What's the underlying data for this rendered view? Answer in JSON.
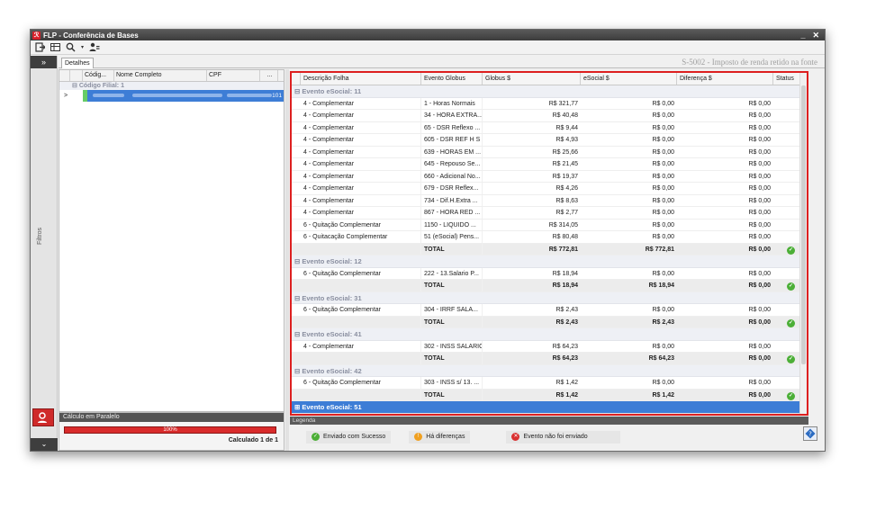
{
  "window": {
    "title": "FLP - Conferência de Bases",
    "minimize": "_",
    "close": "✕"
  },
  "strip": {
    "expand": "»",
    "filters": "Filtros",
    "collapse": "⌄"
  },
  "tab": {
    "label": "Detalhes"
  },
  "report_title": "S-5002 - Imposto de renda retido na fonte",
  "left_grid": {
    "columns": [
      "Códig...",
      "Nome Completo",
      "CPF",
      "..."
    ],
    "group": "Código Filial: 1",
    "selected_row_arrow": ">",
    "selected_row_count": "101"
  },
  "calc": {
    "header": "Cálculo em Paralelo",
    "progress": 100,
    "progress_text": "100%",
    "status": "Calculado 1 de 1"
  },
  "main_grid": {
    "columns": [
      "Descrição Folha",
      "Evento Globus",
      "Globus $",
      "eSocial $",
      "Diferença $",
      "Status"
    ],
    "groups": [
      {
        "header": "⊟ Evento eSocial: 11",
        "rows": [
          [
            "4 - Complementar",
            "1 - Horas Normais",
            "R$ 321,77",
            "R$ 0,00",
            "R$ 0,00"
          ],
          [
            "4 - Complementar",
            "34 - HORA EXTRA...",
            "R$ 40,48",
            "R$ 0,00",
            "R$ 0,00"
          ],
          [
            "4 - Complementar",
            "65 - DSR Reflexo ...",
            "R$ 9,44",
            "R$ 0,00",
            "R$ 0,00"
          ],
          [
            "4 - Complementar",
            "605 - DSR REF H S",
            "R$ 4,93",
            "R$ 0,00",
            "R$ 0,00"
          ],
          [
            "4 - Complementar",
            "639 - HORAS EM ...",
            "R$ 25,66",
            "R$ 0,00",
            "R$ 0,00"
          ],
          [
            "4 - Complementar",
            "645 - Repouso Se...",
            "R$ 21,45",
            "R$ 0,00",
            "R$ 0,00"
          ],
          [
            "4 - Complementar",
            "660 - Adicional No...",
            "R$ 19,37",
            "R$ 0,00",
            "R$ 0,00"
          ],
          [
            "4 - Complementar",
            "679 - DSR Reflex...",
            "R$ 4,26",
            "R$ 0,00",
            "R$ 0,00"
          ],
          [
            "4 - Complementar",
            "734 - Dif.H.Extra ...",
            "R$ 8,63",
            "R$ 0,00",
            "R$ 0,00"
          ],
          [
            "4 - Complementar",
            "867 - HORA RED ...",
            "R$ 2,77",
            "R$ 0,00",
            "R$ 0,00"
          ],
          [
            "6 - Quitação Complementar",
            "1150 - LIQUIDO ...",
            "R$ 314,05",
            "R$ 0,00",
            "R$ 0,00"
          ],
          [
            "6 - Quitacação Complementar",
            "51 (eSocial) Pens...",
            "R$ 80,48",
            "R$ 0,00",
            "R$ 0,00"
          ]
        ],
        "total": [
          "",
          "TOTAL",
          "R$ 772,81",
          "R$ 772,81",
          "R$ 0,00"
        ]
      },
      {
        "header": "⊟ Evento eSocial: 12",
        "rows": [
          [
            "6 - Quitação Complementar",
            "222 - 13.Salario P...",
            "R$ 18,94",
            "R$ 0,00",
            "R$ 0,00"
          ]
        ],
        "total": [
          "",
          "TOTAL",
          "R$ 18,94",
          "R$ 18,94",
          "R$ 0,00"
        ]
      },
      {
        "header": "⊟ Evento eSocial: 31",
        "rows": [
          [
            "6 - Quitação Complementar",
            "304 - IRRF SALA...",
            "R$ 2,43",
            "R$ 0,00",
            "R$ 0,00"
          ]
        ],
        "total": [
          "",
          "TOTAL",
          "R$ 2,43",
          "R$ 2,43",
          "R$ 0,00"
        ]
      },
      {
        "header": "⊟ Evento eSocial: 41",
        "rows": [
          [
            "4 - Complementar",
            "302 - INSS SALARIO",
            "R$ 64,23",
            "R$ 0,00",
            "R$ 0,00"
          ]
        ],
        "total": [
          "",
          "TOTAL",
          "R$ 64,23",
          "R$ 64,23",
          "R$ 0,00"
        ]
      },
      {
        "header": "⊟ Evento eSocial: 42",
        "rows": [
          [
            "6 - Quitação Complementar",
            "303 - INSS s/ 13. ...",
            "R$ 1,42",
            "R$ 0,00",
            "R$ 0,00"
          ]
        ],
        "total": [
          "",
          "TOTAL",
          "R$ 1,42",
          "R$ 1,42",
          "R$ 0,00"
        ]
      }
    ],
    "last_group": "⊞ Evento eSocial: 51",
    "last_group_arrow": ">"
  },
  "legend": {
    "header": "Legenda",
    "items": [
      {
        "label": "Enviado com Sucesso",
        "color": "#4caf37",
        "glyph": "✓"
      },
      {
        "label": "Há diferenças",
        "color": "#f0a020",
        "glyph": "!"
      },
      {
        "label": "Evento não foi enviado",
        "color": "#d93030",
        "glyph": "✕"
      }
    ]
  }
}
